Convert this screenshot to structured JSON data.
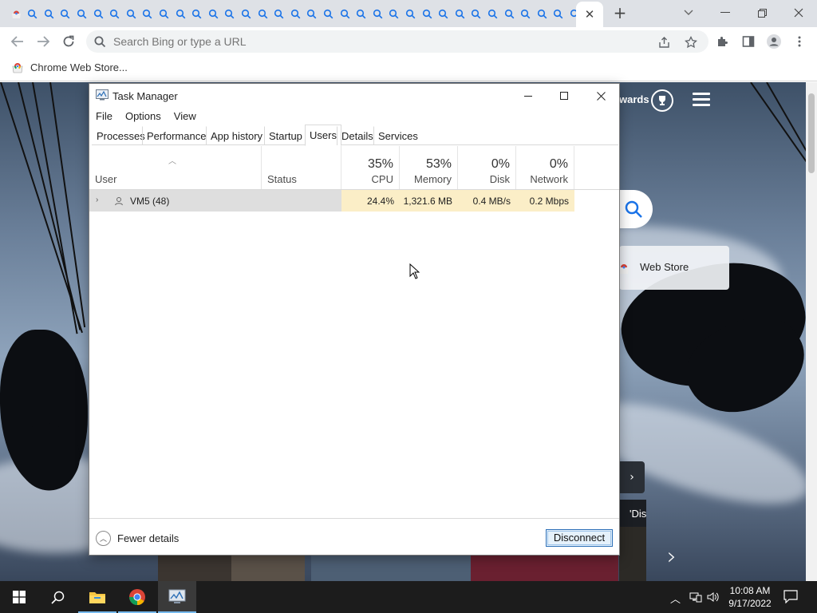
{
  "browser": {
    "tab_count": 35,
    "active_tab_close": "✕",
    "new_tab": "+",
    "omnibox": {
      "placeholder": "Search Bing or type a URL",
      "value": ""
    },
    "bookmarks": [
      {
        "label": "Chrome Web Store..."
      }
    ]
  },
  "bing_page": {
    "rewards_label": "wards",
    "web_store_tile": "Web Store",
    "news_snippet": "'Dis"
  },
  "task_manager": {
    "title": "Task Manager",
    "menu": [
      "File",
      "Options",
      "View"
    ],
    "tabs": [
      "Processes",
      "Performance",
      "App history",
      "Startup",
      "Users",
      "Details",
      "Services"
    ],
    "active_tab": "Users",
    "columns": {
      "user": "User",
      "status": "Status",
      "cpu": {
        "pct": "35%",
        "label": "CPU"
      },
      "memory": {
        "pct": "53%",
        "label": "Memory"
      },
      "disk": {
        "pct": "0%",
        "label": "Disk"
      },
      "network": {
        "pct": "0%",
        "label": "Network"
      }
    },
    "rows": [
      {
        "user": "VM5 (48)",
        "status": "",
        "cpu": "24.4%",
        "memory": "1,321.6 MB",
        "disk": "0.4 MB/s",
        "network": "0.2 Mbps"
      }
    ],
    "footer": {
      "fewer_details": "Fewer details",
      "disconnect": "Disconnect"
    }
  },
  "taskbar": {
    "clock_time": "10:08 AM",
    "clock_date": "9/17/2022"
  },
  "colors": {
    "heat_cell": "#fbeec7",
    "selected_row": "#dedede",
    "tabstrip": "#dee1e6",
    "taskbar": "#1c1c1c",
    "accent": "#2c6fb7"
  }
}
